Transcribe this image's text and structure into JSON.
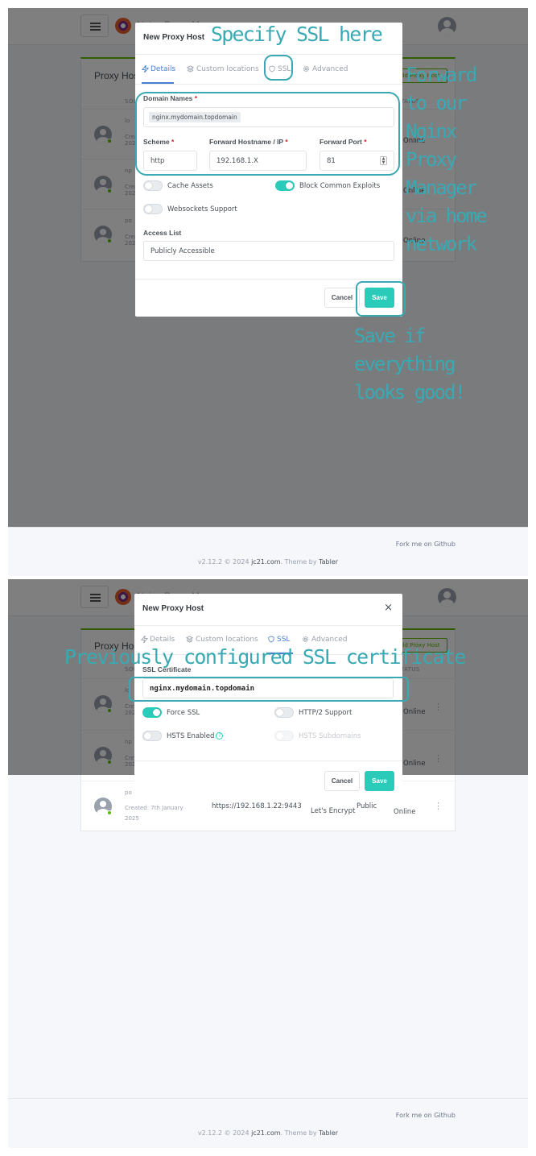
{
  "app": {
    "brand": "Nginx Proxy Manager",
    "list_title": "Proxy Hosts",
    "add_button": "Add Proxy Host",
    "col_source": "SOURCE",
    "col_status": "STATUS",
    "rows": [
      {
        "initial": "lo",
        "created": "Created: 7th January 2025",
        "status": "Online"
      },
      {
        "initial": "np",
        "created": "Created: 7th January 2025",
        "status": "Online"
      },
      {
        "initial": "po",
        "created": "Created: 7th January 2025",
        "destination": "https://192.168.1.22:9443",
        "ssl": "Let's Encrypt",
        "access": "Public",
        "status": "Online"
      }
    ],
    "footer_github": "Fork me on Github",
    "footer_version_prefix": "v2.12.2 © 2024 ",
    "footer_jc21": "jc21.com",
    "footer_theme_by": ". Theme by ",
    "footer_tabler": "Tabler"
  },
  "modal1": {
    "title": "New Proxy Host",
    "tabs": [
      "Details",
      "Custom locations",
      "SSL",
      "Advanced"
    ],
    "domain_label": "Domain Names",
    "domain_value": "nginx.mydomain.topdomain",
    "scheme_label": "Scheme",
    "scheme_value": "http",
    "hostname_label": "Forward Hostname / IP",
    "hostname_value": "192.168.1.X",
    "port_label": "Forward Port",
    "port_value": "81",
    "cache_assets": "Cache Assets",
    "block_exploits": "Block Common Exploits",
    "websockets": "Websockets Support",
    "access_label": "Access List",
    "access_value": "Publicly Accessible",
    "cancel": "Cancel",
    "save": "Save"
  },
  "modal2": {
    "title": "New Proxy Host",
    "close": "×",
    "tabs": [
      "Details",
      "Custom locations",
      "SSL",
      "Advanced"
    ],
    "ssl_cert_label": "SSL Certificate",
    "ssl_cert_value": "nginx.mydomain.topdomain",
    "force_ssl": "Force SSL",
    "http2": "HTTP/2 Support",
    "hsts": "HSTS Enabled",
    "hsts_help": "?",
    "hsts_sub": "HSTS Subdomains",
    "cancel": "Cancel",
    "save": "Save"
  },
  "annotations": {
    "specify_ssl": "Specify SSL here",
    "forward": [
      "Forward",
      "to our",
      "Nginx",
      "Proxy",
      "Manager",
      "via home",
      "network"
    ],
    "save_if": [
      "Save if",
      "everything",
      "looks good!"
    ],
    "previously": "Previously configured SSL certificate"
  },
  "colors": {
    "accent_teal": "#2bcbba",
    "annotation": "#39a9b3",
    "tab_active": "#467fcf",
    "online_green": "#5eba00",
    "required_red": "#cd201f"
  },
  "icons": [
    "hamburger-icon",
    "npm-logo-icon",
    "user-avatar-icon",
    "bolt-icon",
    "layers-icon",
    "shield-icon",
    "gear-icon",
    "close-icon",
    "more-vertical-icon",
    "help-icon"
  ]
}
